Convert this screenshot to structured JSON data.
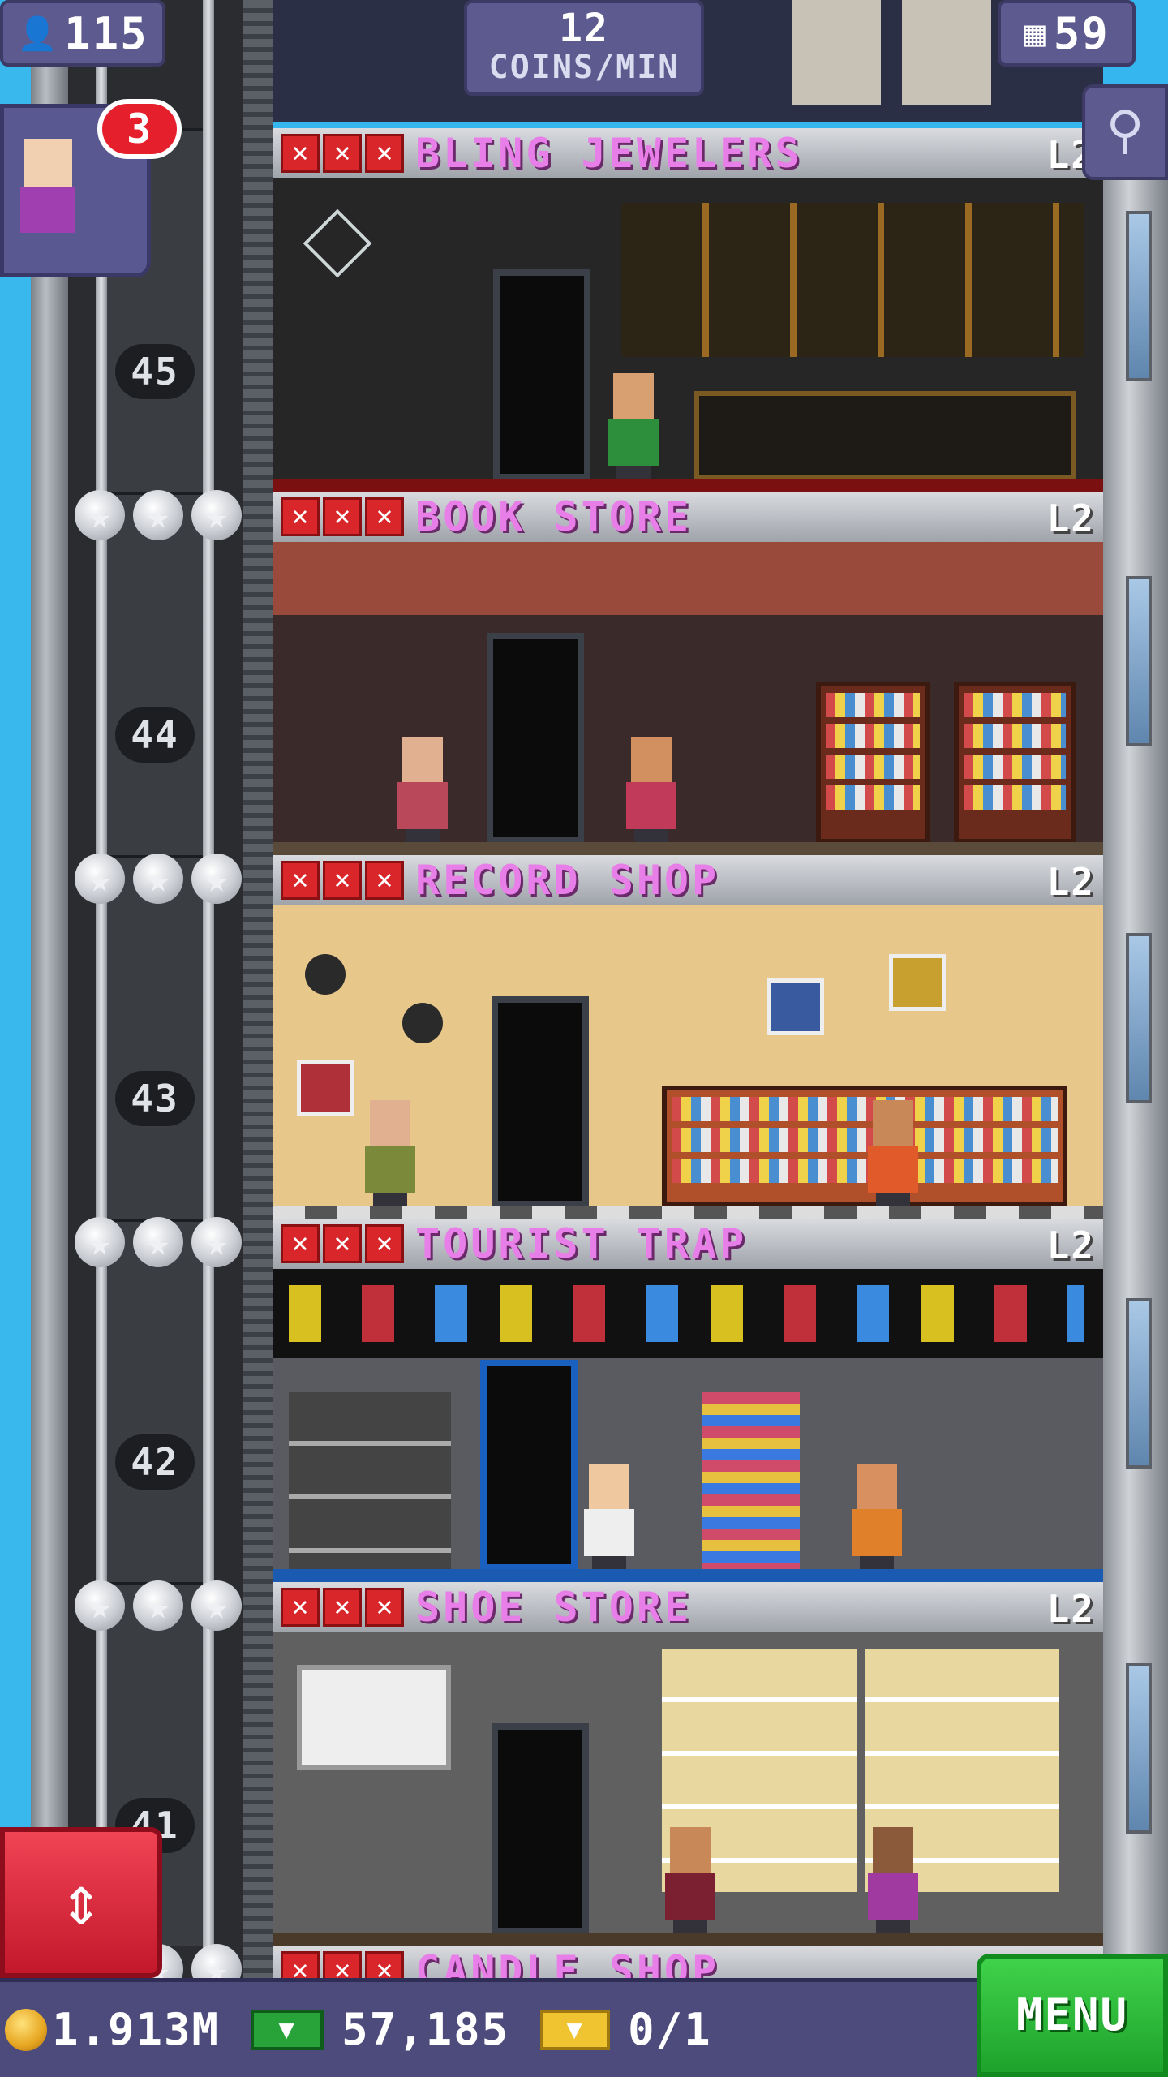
{
  "hud": {
    "population": "115",
    "coins_per_min_value": "12",
    "coins_per_min_label": "COINS/MIN",
    "floor_count": "59",
    "visitor_badge_count": "3",
    "search_icon": "magnifier-icon",
    "elevator_icon": "up-down-arrows-icon"
  },
  "floors": [
    {
      "name": "BLING JEWELERS",
      "level": "L2",
      "number": "45",
      "theme": "#262626"
    },
    {
      "name": "BOOK STORE",
      "level": "L2",
      "number": "44",
      "theme": "#3a2b2a"
    },
    {
      "name": "RECORD SHOP",
      "level": "L2",
      "number": "43",
      "theme": "#e8c88a"
    },
    {
      "name": "TOURIST TRAP",
      "level": "L2",
      "number": "42",
      "theme": "#34353a"
    },
    {
      "name": "SHOE STORE",
      "level": "L2",
      "number": "41",
      "theme": "#606060"
    },
    {
      "name": "CANDLE SHOP"
    }
  ],
  "bottom_bar": {
    "coins": "1.913M",
    "bux": "57,185",
    "tickets": "0/1",
    "menu_label": "MENU"
  },
  "colors": {
    "sky": "#35b6ee",
    "hud_purple": "#5c5a8e",
    "store_name_pink": "#e87fe8",
    "unlock_x_red": "#d9262b",
    "menu_green": "#1ea22c",
    "elevator_red": "#e61f2c"
  }
}
